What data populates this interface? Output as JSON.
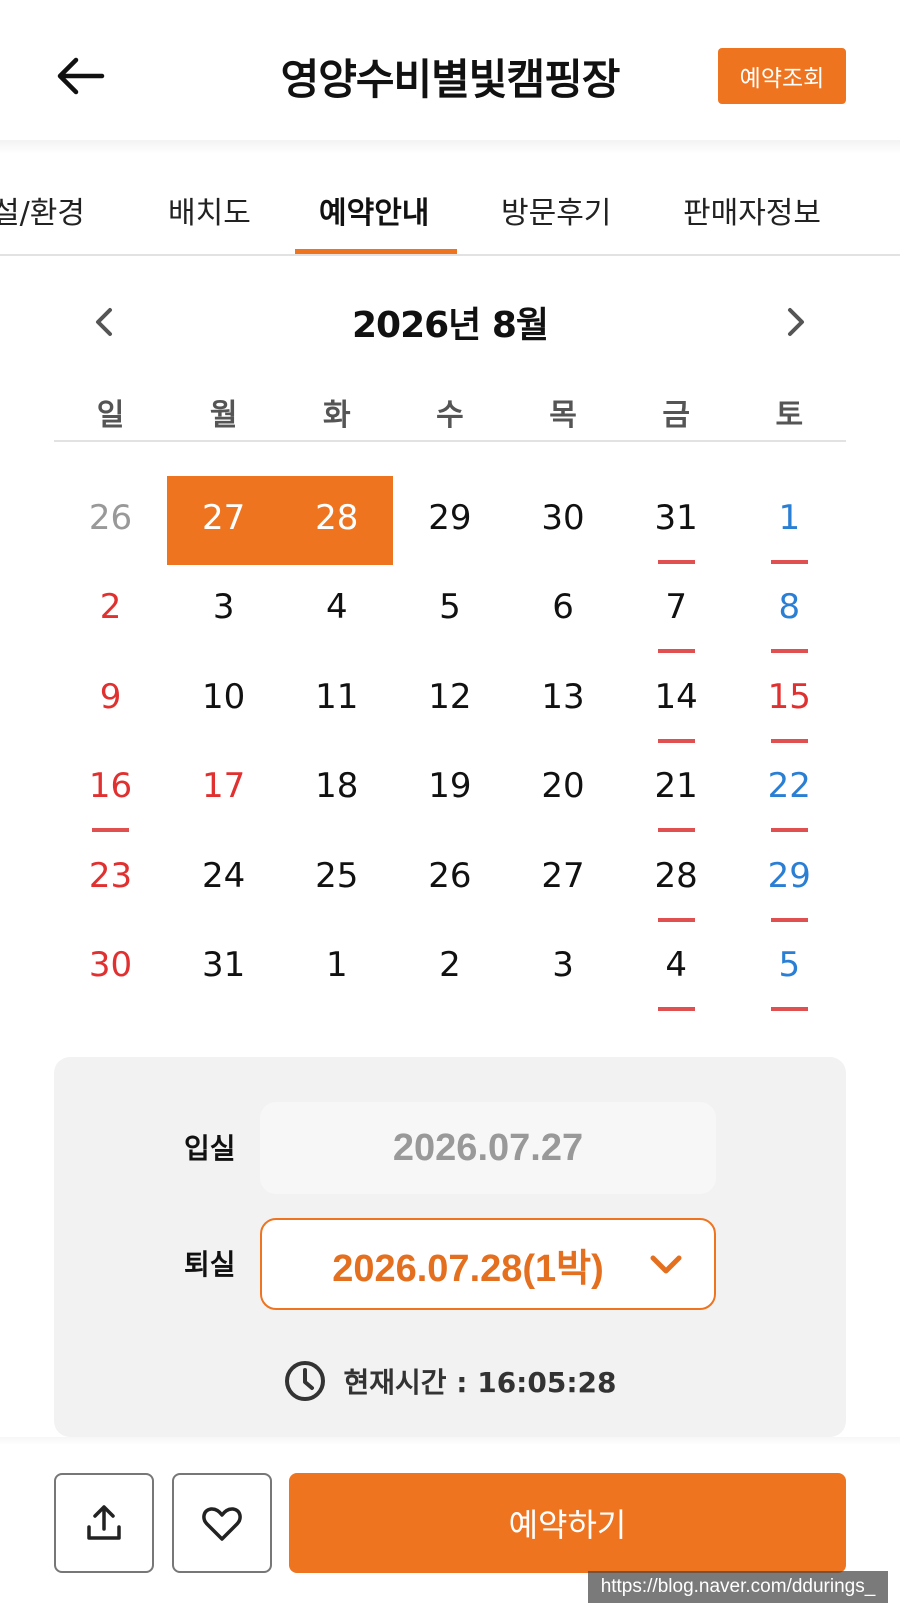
{
  "header": {
    "title": "영양수비별빛캠핑장",
    "lookup_label": "예약조회"
  },
  "tabs": [
    {
      "label": "시설/환경",
      "visible_label": "설/환경"
    },
    {
      "label": "배치도"
    },
    {
      "label": "예약안내",
      "active": true
    },
    {
      "label": "방문후기"
    },
    {
      "label": "판매자정보"
    }
  ],
  "calendar": {
    "month_title": "2026년 8월",
    "weekdays": [
      "일",
      "월",
      "화",
      "수",
      "목",
      "금",
      "토"
    ],
    "rows": [
      [
        "26",
        "27",
        "28",
        "29",
        "30",
        "31",
        "1"
      ],
      [
        "2",
        "3",
        "4",
        "5",
        "6",
        "7",
        "8"
      ],
      [
        "9",
        "10",
        "11",
        "12",
        "13",
        "14",
        "15"
      ],
      [
        "16",
        "17",
        "18",
        "19",
        "20",
        "21",
        "22"
      ],
      [
        "23",
        "24",
        "25",
        "26",
        "27",
        "28",
        "29"
      ],
      [
        "30",
        "31",
        "1",
        "2",
        "3",
        "4",
        "5"
      ]
    ],
    "selected": [
      "27",
      "28"
    ]
  },
  "booking": {
    "checkin_label": "입실",
    "checkin_value": "2026.07.27",
    "checkout_label": "퇴실",
    "checkout_value": "2026.07.28(1박)",
    "now_time_text": "현재시간 : 16:05:28"
  },
  "bottom": {
    "reserve_label": "예약하기"
  },
  "watermark": "https://blog.naver.com/ddurings_",
  "colors": {
    "accent": "#ee7420",
    "holiday_red": "#e03030",
    "saturday_blue": "#2a7fd4",
    "mark_bar": "#e05050"
  }
}
